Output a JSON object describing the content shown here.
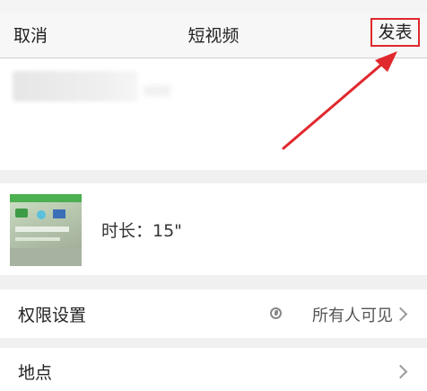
{
  "nav": {
    "cancel_label": "取消",
    "title": "短视频",
    "publish_label": "发表"
  },
  "video": {
    "duration_label": "时长：15\""
  },
  "settings": [
    {
      "label": "权限设置",
      "value": "所有人可见",
      "icon": "globe-icon"
    },
    {
      "label": "地点",
      "value": ""
    }
  ],
  "colors": {
    "highlight": "#e0282d",
    "background": "#f0f0f0"
  }
}
